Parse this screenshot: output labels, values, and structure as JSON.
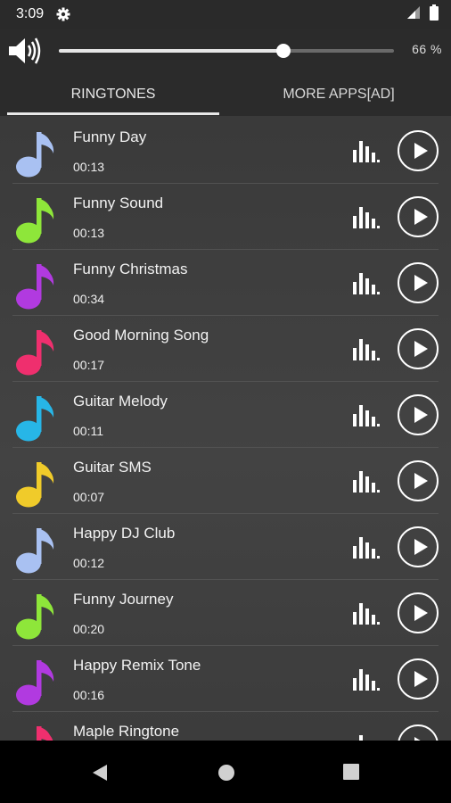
{
  "status": {
    "time": "3:09"
  },
  "volume": {
    "percent_label": "66 %",
    "level": 0.66
  },
  "tabs": [
    {
      "label": "RINGTONES",
      "selected": true
    },
    {
      "label": "MORE APPS[AD]",
      "selected": false
    }
  ],
  "ringtones": [
    {
      "title": "Funny Day",
      "duration": "00:13",
      "color": "#a9c1f2"
    },
    {
      "title": "Funny Sound",
      "duration": "00:13",
      "color": "#8ee63a"
    },
    {
      "title": "Funny Christmas",
      "duration": "00:34",
      "color": "#b13ae0"
    },
    {
      "title": "Good Morning Song",
      "duration": "00:17",
      "color": "#ef2f6e"
    },
    {
      "title": "Guitar Melody",
      "duration": "00:11",
      "color": "#27b6e7"
    },
    {
      "title": "Guitar SMS",
      "duration": "00:07",
      "color": "#f0cb2a"
    },
    {
      "title": "Happy DJ Club",
      "duration": "00:12",
      "color": "#a9c1f2"
    },
    {
      "title": "Funny Journey",
      "duration": "00:20",
      "color": "#8ee63a"
    },
    {
      "title": "Happy Remix Tone",
      "duration": "00:16",
      "color": "#b13ae0"
    },
    {
      "title": "Maple Ringtone",
      "duration": "",
      "color": "#ef2f6e"
    }
  ],
  "icons": {
    "settings": "gear-icon",
    "signal": "signal-icon",
    "battery": "battery-icon",
    "volume": "speaker-icon",
    "note": "music-note-icon",
    "equalizer": "equalizer-icon",
    "play": "play-icon",
    "back": "back-icon",
    "home": "home-icon",
    "recents": "recents-icon"
  }
}
